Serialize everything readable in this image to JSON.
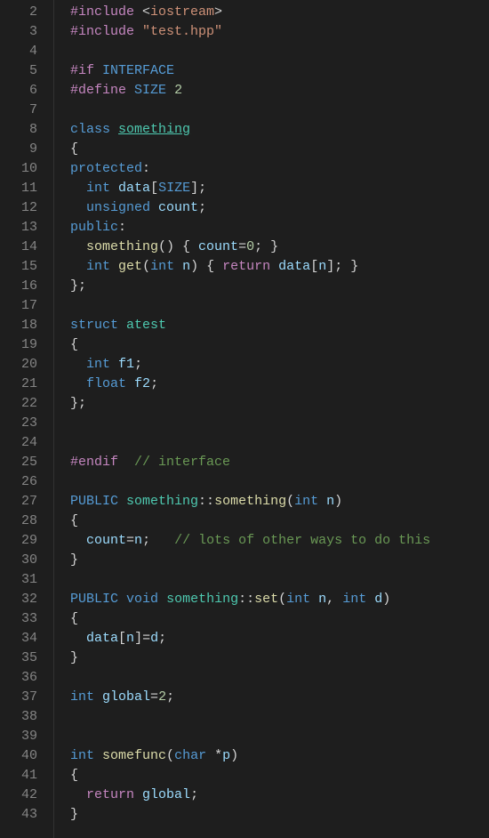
{
  "chart_data": null,
  "editor": {
    "first_line_number": 2,
    "lines": [
      [
        [
          "pp",
          "#include"
        ],
        [
          "punct",
          " <"
        ],
        [
          "str",
          "iostream"
        ],
        [
          "punct",
          ">"
        ]
      ],
      [
        [
          "pp",
          "#include"
        ],
        [
          "punct",
          " "
        ],
        [
          "str",
          "\"test.hpp\""
        ]
      ],
      [],
      [
        [
          "pp",
          "#if"
        ],
        [
          "punct",
          " "
        ],
        [
          "macro",
          "INTERFACE"
        ]
      ],
      [
        [
          "pp",
          "#define"
        ],
        [
          "punct",
          " "
        ],
        [
          "macro",
          "SIZE"
        ],
        [
          "punct",
          " "
        ],
        [
          "num",
          "2"
        ]
      ],
      [],
      [
        [
          "kw",
          "class"
        ],
        [
          "punct",
          " "
        ],
        [
          "type underline",
          "something"
        ]
      ],
      [
        [
          "punct",
          "{"
        ]
      ],
      [
        [
          "kw",
          "protected"
        ],
        [
          "punct",
          ":"
        ]
      ],
      [
        [
          "punct",
          "  "
        ],
        [
          "kw",
          "int"
        ],
        [
          "punct",
          " "
        ],
        [
          "var",
          "data"
        ],
        [
          "punct",
          "["
        ],
        [
          "macro",
          "SIZE"
        ],
        [
          "punct",
          "];"
        ]
      ],
      [
        [
          "punct",
          "  "
        ],
        [
          "kw",
          "unsigned"
        ],
        [
          "punct",
          " "
        ],
        [
          "var",
          "count"
        ],
        [
          "punct",
          ";"
        ]
      ],
      [
        [
          "kw",
          "public"
        ],
        [
          "punct",
          ":"
        ]
      ],
      [
        [
          "punct",
          "  "
        ],
        [
          "fn",
          "something"
        ],
        [
          "punct",
          "() { "
        ],
        [
          "var",
          "count"
        ],
        [
          "punct",
          "="
        ],
        [
          "num",
          "0"
        ],
        [
          "punct",
          "; }"
        ]
      ],
      [
        [
          "punct",
          "  "
        ],
        [
          "kw",
          "int"
        ],
        [
          "punct",
          " "
        ],
        [
          "fn",
          "get"
        ],
        [
          "punct",
          "("
        ],
        [
          "kw",
          "int"
        ],
        [
          "punct",
          " "
        ],
        [
          "param",
          "n"
        ],
        [
          "punct",
          ") { "
        ],
        [
          "kwctrl",
          "return"
        ],
        [
          "punct",
          " "
        ],
        [
          "var",
          "data"
        ],
        [
          "punct",
          "["
        ],
        [
          "var",
          "n"
        ],
        [
          "punct",
          "]; }"
        ]
      ],
      [
        [
          "punct",
          "};"
        ]
      ],
      [],
      [
        [
          "kw",
          "struct"
        ],
        [
          "punct",
          " "
        ],
        [
          "type",
          "atest"
        ]
      ],
      [
        [
          "punct",
          "{"
        ]
      ],
      [
        [
          "punct",
          "  "
        ],
        [
          "kw",
          "int"
        ],
        [
          "punct",
          " "
        ],
        [
          "var",
          "f1"
        ],
        [
          "punct",
          ";"
        ]
      ],
      [
        [
          "punct",
          "  "
        ],
        [
          "kw",
          "float"
        ],
        [
          "punct",
          " "
        ],
        [
          "var",
          "f2"
        ],
        [
          "punct",
          ";"
        ]
      ],
      [
        [
          "punct",
          "};"
        ]
      ],
      [],
      [],
      [
        [
          "pp",
          "#endif"
        ],
        [
          "punct",
          "  "
        ],
        [
          "cmt",
          "// interface"
        ]
      ],
      [],
      [
        [
          "macro",
          "PUBLIC"
        ],
        [
          "punct",
          " "
        ],
        [
          "type",
          "something"
        ],
        [
          "punct",
          "::"
        ],
        [
          "fn",
          "something"
        ],
        [
          "punct",
          "("
        ],
        [
          "kw",
          "int"
        ],
        [
          "punct",
          " "
        ],
        [
          "param",
          "n"
        ],
        [
          "punct",
          ")"
        ]
      ],
      [
        [
          "punct",
          "{"
        ]
      ],
      [
        [
          "punct",
          "  "
        ],
        [
          "var",
          "count"
        ],
        [
          "punct",
          "="
        ],
        [
          "var",
          "n"
        ],
        [
          "punct",
          ";   "
        ],
        [
          "cmt",
          "// lots of other ways to do this"
        ]
      ],
      [
        [
          "punct",
          "}"
        ]
      ],
      [],
      [
        [
          "macro",
          "PUBLIC"
        ],
        [
          "punct",
          " "
        ],
        [
          "kw",
          "void"
        ],
        [
          "punct",
          " "
        ],
        [
          "type",
          "something"
        ],
        [
          "punct",
          "::"
        ],
        [
          "fn",
          "set"
        ],
        [
          "punct",
          "("
        ],
        [
          "kw",
          "int"
        ],
        [
          "punct",
          " "
        ],
        [
          "param",
          "n"
        ],
        [
          "punct",
          ", "
        ],
        [
          "kw",
          "int"
        ],
        [
          "punct",
          " "
        ],
        [
          "param",
          "d"
        ],
        [
          "punct",
          ")"
        ]
      ],
      [
        [
          "punct",
          "{"
        ]
      ],
      [
        [
          "punct",
          "  "
        ],
        [
          "var",
          "data"
        ],
        [
          "punct",
          "["
        ],
        [
          "var",
          "n"
        ],
        [
          "punct",
          "]="
        ],
        [
          "var",
          "d"
        ],
        [
          "punct",
          ";"
        ]
      ],
      [
        [
          "punct",
          "}"
        ]
      ],
      [],
      [
        [
          "kw",
          "int"
        ],
        [
          "punct",
          " "
        ],
        [
          "var",
          "global"
        ],
        [
          "punct",
          "="
        ],
        [
          "num",
          "2"
        ],
        [
          "punct",
          ";"
        ]
      ],
      [],
      [],
      [
        [
          "kw",
          "int"
        ],
        [
          "punct",
          " "
        ],
        [
          "fn",
          "somefunc"
        ],
        [
          "punct",
          "("
        ],
        [
          "kw",
          "char"
        ],
        [
          "punct",
          " *"
        ],
        [
          "param",
          "p"
        ],
        [
          "punct",
          ")"
        ]
      ],
      [
        [
          "punct",
          "{"
        ]
      ],
      [
        [
          "punct",
          "  "
        ],
        [
          "kwctrl",
          "return"
        ],
        [
          "punct",
          " "
        ],
        [
          "var",
          "global"
        ],
        [
          "punct",
          ";"
        ]
      ],
      [
        [
          "punct",
          "}"
        ]
      ]
    ]
  }
}
